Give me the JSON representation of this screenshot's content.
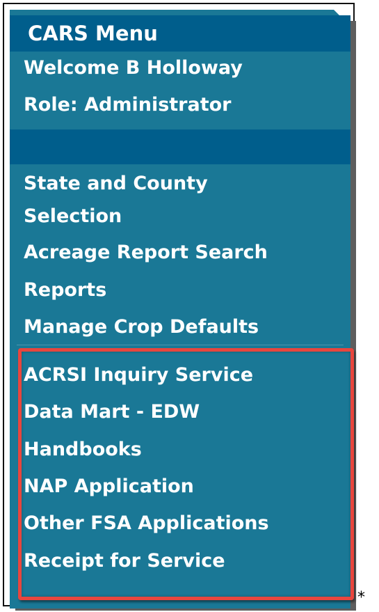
{
  "menu": {
    "title": "CARS Menu",
    "welcome": "Welcome B Holloway",
    "role": "Role: Administrator",
    "items": [
      "State and County",
      "Selection",
      "Acreage Report Search",
      "Reports",
      "Manage Crop Defaults"
    ],
    "highlighted_items": [
      "ACRSI Inquiry Service",
      "Data Mart - EDW",
      "Handbooks",
      "NAP Application",
      "Other FSA Applications",
      "Receipt for Service"
    ]
  },
  "footnote_marker": "*",
  "colors": {
    "panel": "#1a7896",
    "header": "#005e8c",
    "highlight_border": "#e8463e",
    "text": "#ffffff"
  }
}
